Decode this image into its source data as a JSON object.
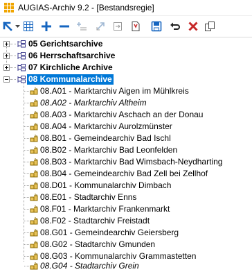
{
  "window": {
    "title": "AUGIAS-Archiv 9.2 - [Bestandsregie]"
  },
  "toolbar": {
    "buttons": [
      {
        "icon": "arrow-up-left-icon",
        "color": "#1565c0"
      },
      {
        "icon": "dropdown-arrow-icon"
      },
      {
        "icon": "table-grid-icon"
      },
      {
        "icon": "plus-icon",
        "color": "#1565c0"
      },
      {
        "icon": "minus-icon",
        "color": "#1565c0"
      },
      {
        "icon": "add-list-icon"
      },
      {
        "icon": "move-icon"
      },
      {
        "icon": "import-icon"
      },
      {
        "icon": "marked-document-icon"
      },
      {
        "icon": "save-icon",
        "color": "#1565c0"
      },
      {
        "icon": "undo-icon"
      },
      {
        "icon": "delete-icon",
        "color": "#c62828"
      },
      {
        "icon": "copy-icon"
      }
    ]
  },
  "tree": {
    "categories": [
      {
        "label": "05 Gerichtsarchive",
        "expanded": false,
        "selected": false
      },
      {
        "label": "06 Herrschaftsarchive",
        "expanded": false,
        "selected": false
      },
      {
        "label": "07 Kirchliche Archive",
        "expanded": false,
        "selected": false
      },
      {
        "label": "08 Kommunalarchive",
        "expanded": true,
        "selected": true
      }
    ],
    "children": [
      {
        "label": "08.A01 - Marktarchiv Aigen im Mühlkreis",
        "italic": false
      },
      {
        "label": "08.A02 - Marktarchiv Altheim",
        "italic": true
      },
      {
        "label": "08.A03 - Marktarchiv Aschach an der Donau",
        "italic": false
      },
      {
        "label": "08.A04 - Marktarchiv Aurolzmünster",
        "italic": false
      },
      {
        "label": "08.B01 - Gemeindearchiv Bad Ischl",
        "italic": false
      },
      {
        "label": "08.B02 - Marktarchiv Bad Leonfelden",
        "italic": false
      },
      {
        "label": "08.B03 - Marktarchiv Bad Wimsbach-Neydharting",
        "italic": false
      },
      {
        "label": "08.B04 - Gemeindearchiv Bad Zell bei Zellhof",
        "italic": false
      },
      {
        "label": "08.D01 - Kommunalarchiv Dimbach",
        "italic": false
      },
      {
        "label": "08.E01 - Stadtarchiv Enns",
        "italic": false
      },
      {
        "label": "08.F01 - Marktarchiv Frankenmarkt",
        "italic": false
      },
      {
        "label": "08.F02 - Stadtarchiv Freistadt",
        "italic": false
      },
      {
        "label": "08.G01 - Gemeindearchiv Geiersberg",
        "italic": false
      },
      {
        "label": "08.G02 - Stadtarchiv Gmunden",
        "italic": false
      },
      {
        "label": "08.G03 - Kommunalarchiv Grammastetten",
        "italic": false
      },
      {
        "label": "08.G04 - Stadtarchiv Grein",
        "italic": true
      }
    ]
  },
  "colors": {
    "selection": "#0078d7",
    "app_icon": "#f0a500",
    "category_icon": "#3a3a8c",
    "leaf_icon": "#8a6a00"
  }
}
